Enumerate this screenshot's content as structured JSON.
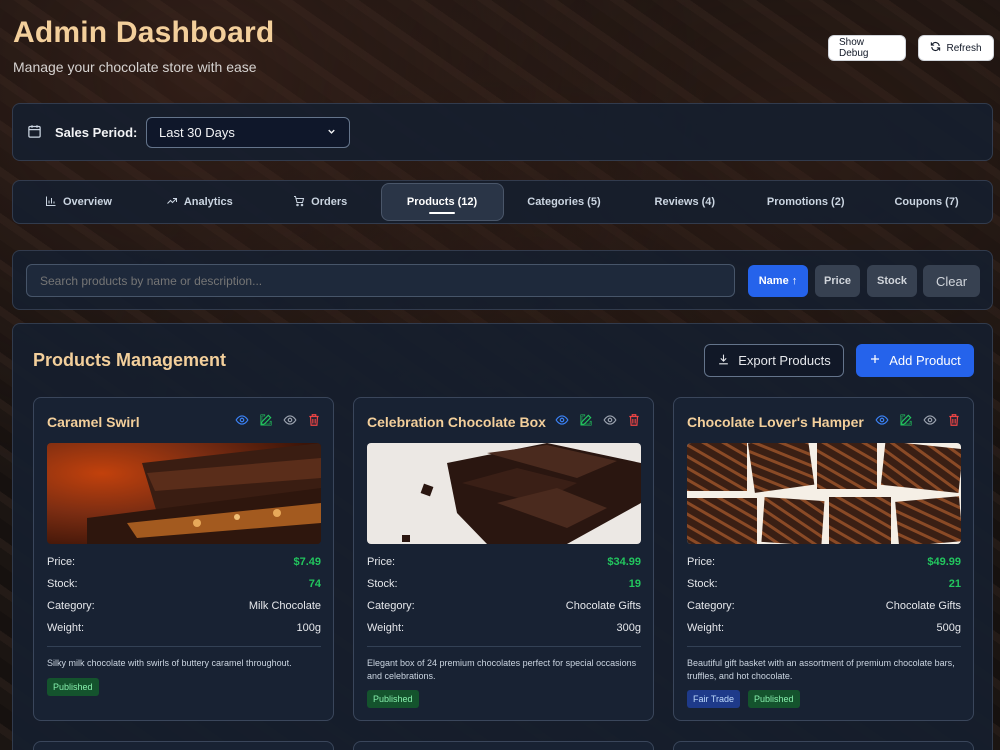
{
  "header": {
    "title": "Admin Dashboard",
    "subtitle": "Manage your chocolate store with ease",
    "debug_label": "Show Debug",
    "refresh_label": "Refresh"
  },
  "period": {
    "label": "Sales Period:",
    "selected": "Last 30 Days"
  },
  "tabs": [
    {
      "label": "Overview"
    },
    {
      "label": "Analytics"
    },
    {
      "label": "Orders"
    },
    {
      "label": "Products (12)"
    },
    {
      "label": "Categories (5)"
    },
    {
      "label": "Reviews (4)"
    },
    {
      "label": "Promotions (2)"
    },
    {
      "label": "Coupons (7)"
    }
  ],
  "search": {
    "placeholder": "Search products by name or description...",
    "sort_name": "Name ↑",
    "sort_price": "Price",
    "sort_stock": "Stock",
    "clear": "Clear"
  },
  "main": {
    "title": "Products Management",
    "export_label": "Export Products",
    "add_label": "Add Product"
  },
  "labels": {
    "price": "Price:",
    "stock": "Stock:",
    "category": "Category:",
    "weight": "Weight:"
  },
  "products": [
    {
      "name": "Caramel Swirl",
      "price": "$7.49",
      "stock": "74",
      "category": "Milk Chocolate",
      "weight": "100g",
      "description": "Silky milk chocolate with swirls of buttery caramel throughout.",
      "badges": [
        "Published"
      ]
    },
    {
      "name": "Celebration Chocolate Box",
      "price": "$34.99",
      "stock": "19",
      "category": "Chocolate Gifts",
      "weight": "300g",
      "description": "Elegant box of 24 premium chocolates perfect for special occasions and celebrations.",
      "badges": [
        "Published"
      ]
    },
    {
      "name": "Chocolate Lover's Hamper",
      "price": "$49.99",
      "stock": "21",
      "category": "Chocolate Gifts",
      "weight": "500g",
      "description": "Beautiful gift basket with an assortment of premium chocolate bars, truffles, and hot chocolate.",
      "badges": [
        "Fair Trade",
        "Published"
      ]
    }
  ],
  "colors": {
    "accent": "#2563eb",
    "title": "#f3cf9b",
    "price_green": "#22c55e"
  }
}
